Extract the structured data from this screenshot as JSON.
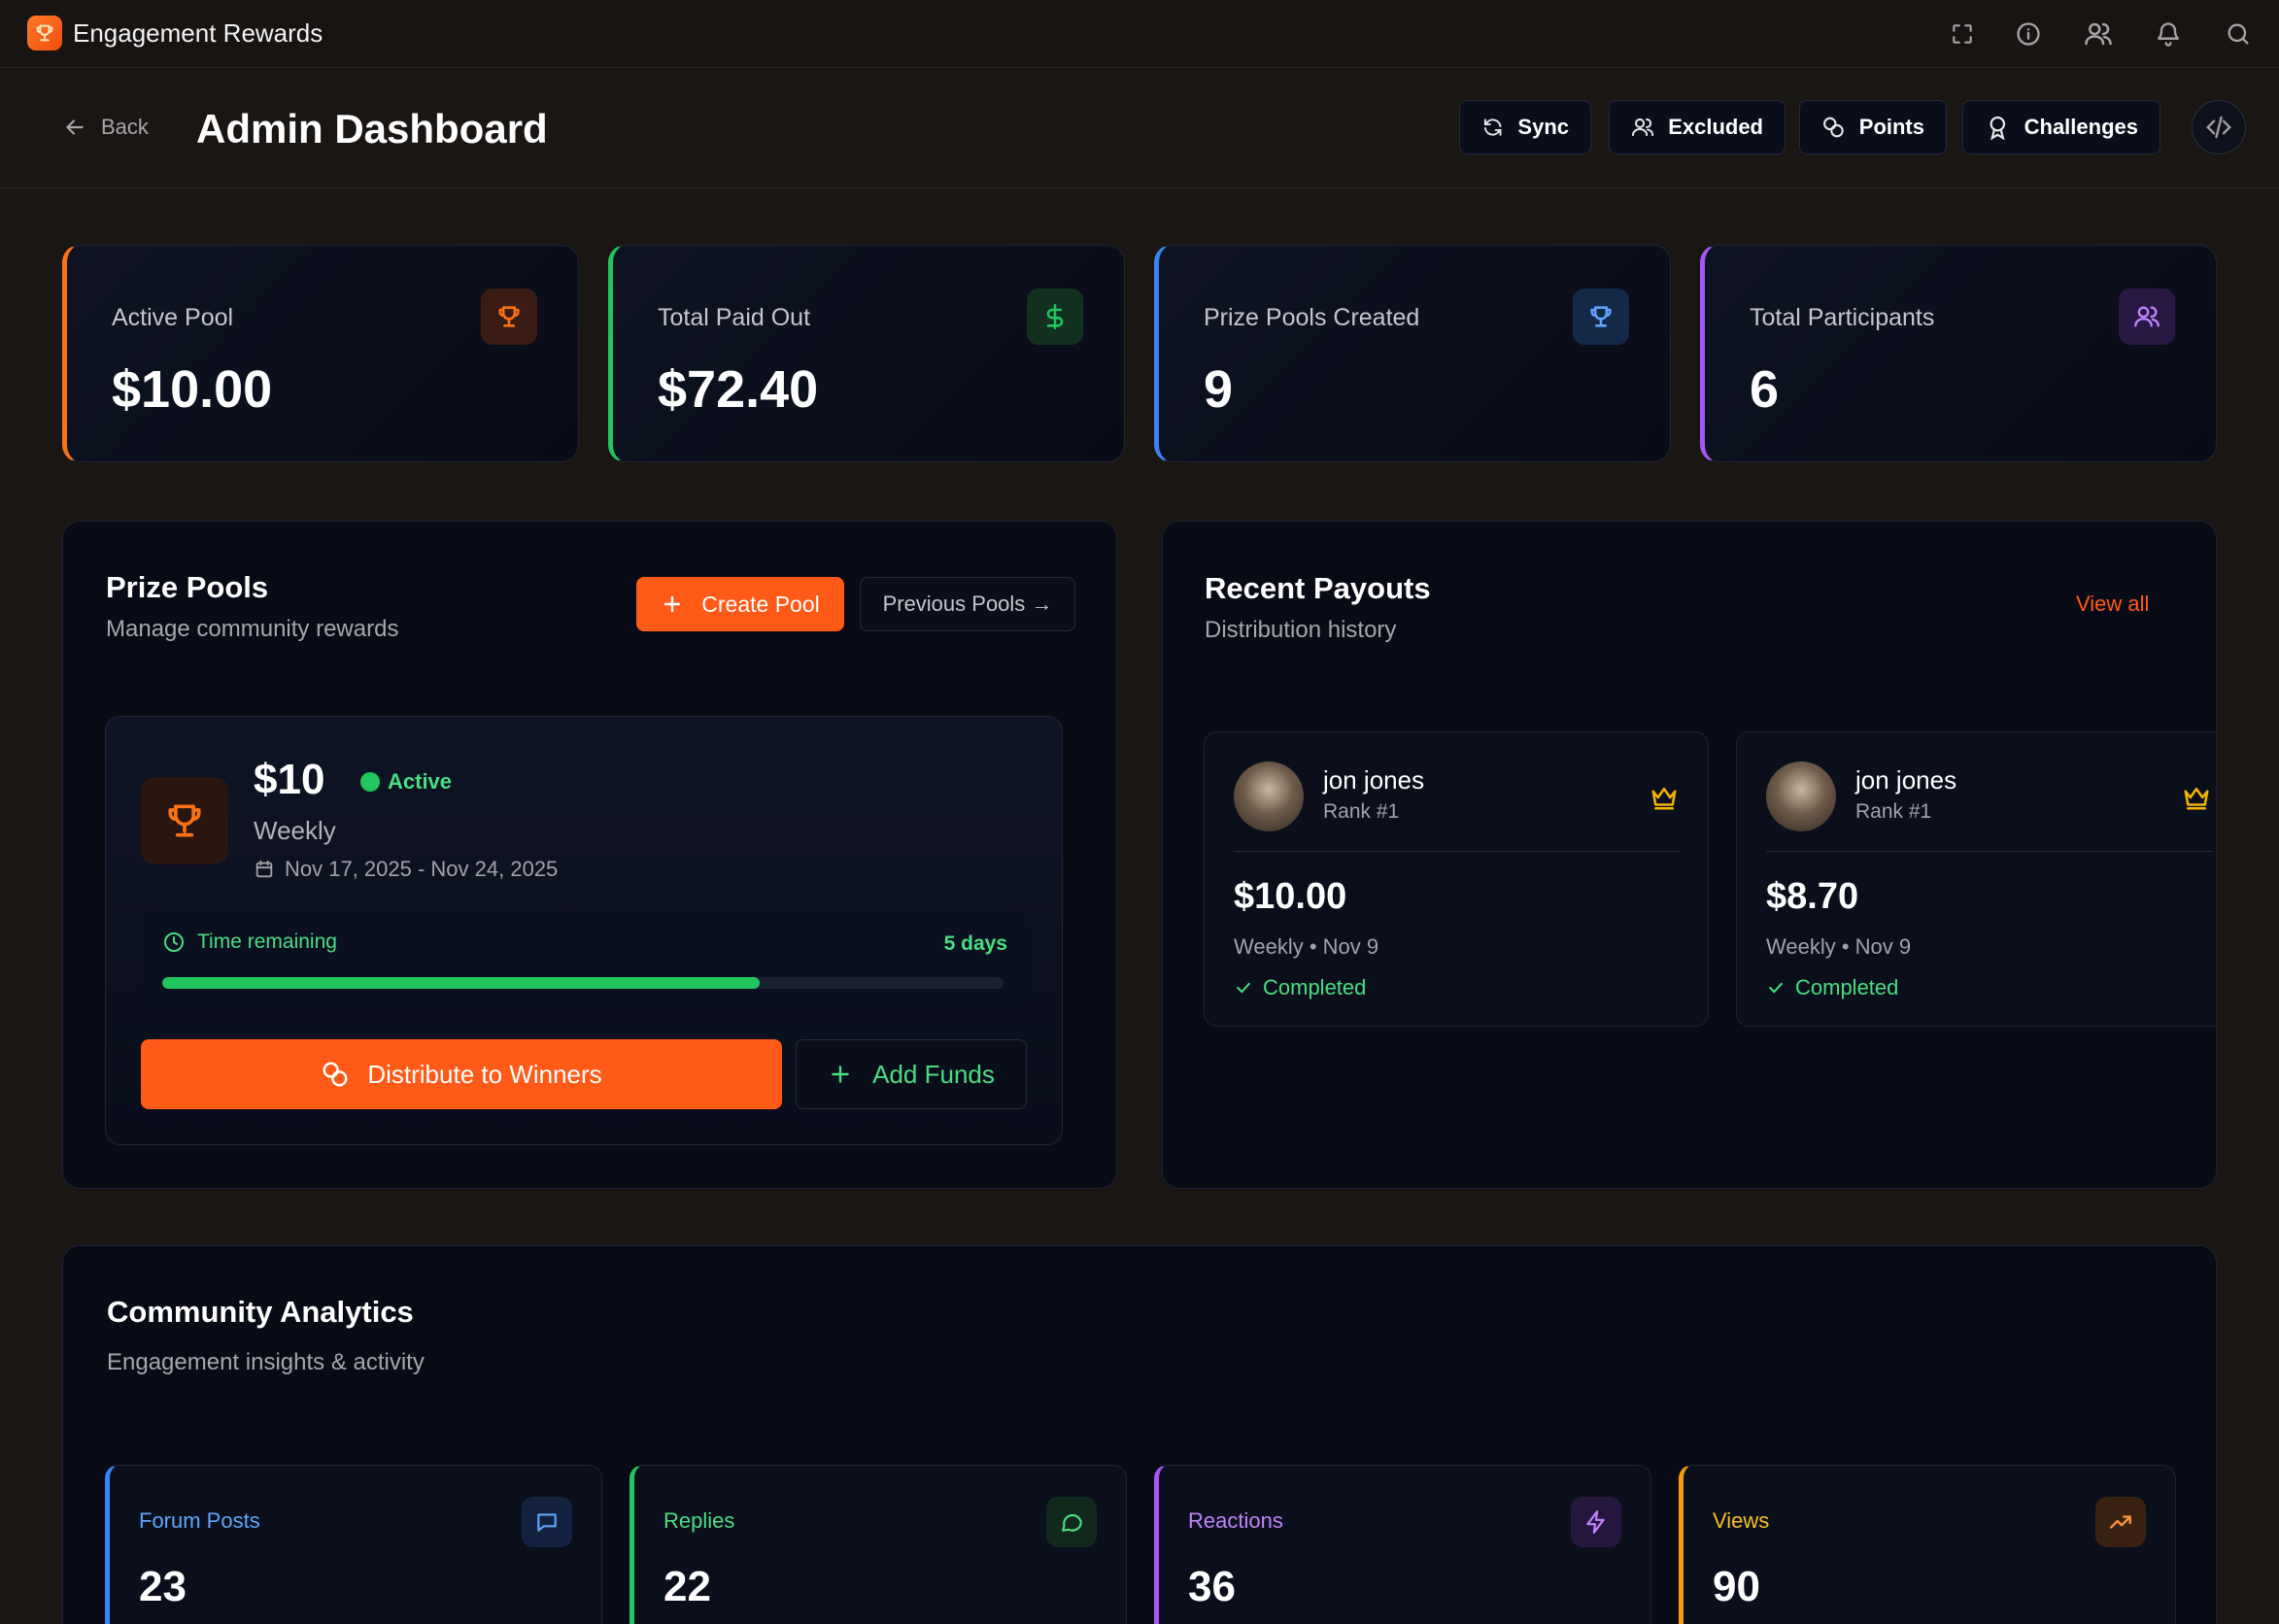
{
  "app": {
    "title": "Engagement Rewards"
  },
  "header": {
    "back_label": "Back",
    "title": "Admin Dashboard",
    "buttons": {
      "sync": "Sync",
      "excluded": "Excluded",
      "points": "Points",
      "challenges": "Challenges"
    }
  },
  "stats": [
    {
      "label": "Active Pool",
      "value": "$10.00",
      "color": "#f97316",
      "icon": "trophy-icon"
    },
    {
      "label": "Total Paid Out",
      "value": "$72.40",
      "color": "#22c55e",
      "icon": "dollar-icon"
    },
    {
      "label": "Prize Pools Created",
      "value": "9",
      "color": "#3b82f6",
      "icon": "trophy-icon"
    },
    {
      "label": "Total Participants",
      "value": "6",
      "color": "#a855f7",
      "icon": "users-icon"
    }
  ],
  "prize_pools": {
    "title": "Prize Pools",
    "subtitle": "Manage community rewards",
    "create_label": "Create Pool",
    "previous_label": "Previous Pools →",
    "pool": {
      "amount": "$10",
      "status": "Active",
      "period": "Weekly",
      "dates": "Nov 17, 2025 - Nov 24, 2025",
      "time_label": "Time remaining",
      "time_value": "5 days",
      "progress": 0.71,
      "distribute_label": "Distribute to Winners",
      "add_funds_label": "Add Funds"
    }
  },
  "recent_payouts": {
    "title": "Recent Payouts",
    "subtitle": "Distribution history",
    "view_all": "View all",
    "items": [
      {
        "name": "jon jones",
        "rank": "Rank #1",
        "amount": "$10.00",
        "meta": "Weekly • Nov 9",
        "status": "Completed"
      },
      {
        "name": "jon jones",
        "rank": "Rank #1",
        "amount": "$8.70",
        "meta": "Weekly • Nov 9",
        "status": "Completed"
      }
    ]
  },
  "analytics": {
    "title": "Community Analytics",
    "subtitle": "Engagement insights & activity",
    "cards": [
      {
        "label": "Forum Posts",
        "value": "23",
        "color": "#3b82f6",
        "icon": "message-square-icon"
      },
      {
        "label": "Replies",
        "value": "22",
        "color": "#22c55e",
        "icon": "message-circle-icon"
      },
      {
        "label": "Reactions",
        "value": "36",
        "color": "#a855f7",
        "icon": "zap-icon"
      },
      {
        "label": "Views",
        "value": "90",
        "color": "#f59e0b",
        "icon": "trending-up-icon"
      }
    ]
  }
}
